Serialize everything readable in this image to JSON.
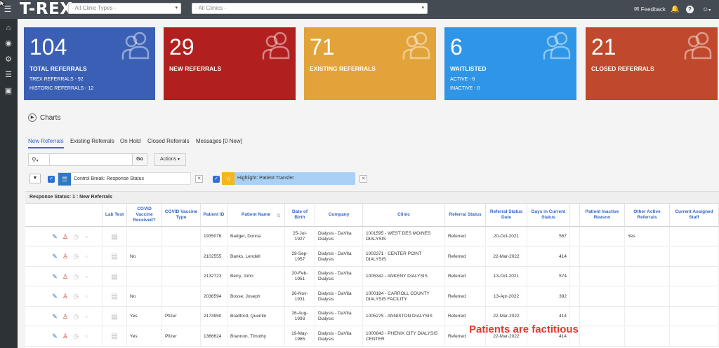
{
  "topbar": {
    "menu_icon": "hamburger-icon",
    "logo": "T-REX",
    "clinic_types": {
      "selected": "- All Clinic Types -"
    },
    "clinics": {
      "selected": "- All Clinics -"
    },
    "feedback_label": "Feedback",
    "feedback_icon": "chat-bubble-icon",
    "notifications_icon": "bell-icon",
    "help_icon": "question-icon",
    "user_icon": "user-icon"
  },
  "sidebar": {
    "items": [
      {
        "icon": "home-icon"
      },
      {
        "icon": "eye-slash-icon"
      },
      {
        "icon": "gear-icon"
      },
      {
        "icon": "list-icon"
      },
      {
        "icon": "book-icon"
      }
    ]
  },
  "cards": [
    {
      "value": "104",
      "label": "TOTAL REFERRALS",
      "sub1": "TREX REFERRALS - 92",
      "sub2": "HISTORIC REFERRALS - 12",
      "color": "#3a5fb4"
    },
    {
      "value": "29",
      "label": "NEW REFERRALS",
      "sub1": "",
      "sub2": "",
      "color": "#b21f1f"
    },
    {
      "value": "71",
      "label": "EXISTING REFERRALS",
      "sub1": "",
      "sub2": "",
      "color": "#e2a33a"
    },
    {
      "value": "6",
      "label": "WAITLISTED",
      "sub1": "ACTIVE - 6",
      "sub2": "INACTIVE - 0",
      "color": "#2f95e6"
    },
    {
      "value": "21",
      "label": "CLOSED REFERRALS",
      "sub1": "",
      "sub2": "",
      "color": "#c0492d"
    }
  ],
  "charts": {
    "label": "Charts"
  },
  "tabs": [
    {
      "label": "New Referrals",
      "active": true
    },
    {
      "label": "Existing Referrals",
      "active": false
    },
    {
      "label": "On Hold",
      "active": false
    },
    {
      "label": "Closed Referrals",
      "active": false
    },
    {
      "label": "Messages [0 New]",
      "active": false
    }
  ],
  "toolbar": {
    "search_value": "",
    "go_label": "Go",
    "actions_label": "Actions"
  },
  "filters": {
    "control_break": "Control Break: Response Status",
    "highlight": "Highlight: Patient Transfer"
  },
  "table": {
    "group_header": "Response Status: 1 : New Referrals",
    "columns": [
      "",
      "Lab Test",
      "COVID Vaccine Received?",
      "COVID Vaccine Type",
      "Patient ID",
      "Patient Name",
      "Date of Birth",
      "Company",
      "Clinic",
      "Referral Status",
      "Referral Status Date",
      "Days in Current Status",
      "",
      "Patient Inactive Reason",
      "Other Active Referrals",
      "Current Assigned Staff"
    ],
    "rows": [
      {
        "covid": "",
        "type": "",
        "id": "1935076",
        "name": "Badger, Donna",
        "dob": "25-Jul-1927",
        "company": "Dialysis - DaVita Dialysis",
        "clinic": "1001595 - WEST DES MOINES DIALYSIS",
        "status": "Referred",
        "date": "20-Oct-2021",
        "days": "567",
        "reason": "",
        "other": "Yes",
        "staff": ""
      },
      {
        "covid": "No",
        "type": "",
        "id": "2102555",
        "name": "Banks, Lendell",
        "dob": "29-Sep-1957",
        "company": "Dialysis - DaVita Dialysis",
        "clinic": "1002371 - CENTER POINT DIALYSIS",
        "status": "Referred",
        "date": "22-Mar-2022",
        "days": "414",
        "reason": "",
        "other": "",
        "staff": ""
      },
      {
        "covid": "",
        "type": "",
        "id": "2132723",
        "name": "Berry, John",
        "dob": "20-Feb-1951",
        "company": "Dialysis - DaVita Dialysis",
        "clinic": "1005342 - ANKENY DIALYSIS",
        "status": "Referred",
        "date": "13-Oct-2021",
        "days": "574",
        "reason": "",
        "other": "",
        "staff": ""
      },
      {
        "covid": "No",
        "type": "",
        "id": "2036594",
        "name": "Bosse, Joseph",
        "dob": "26-Nov-1931",
        "company": "Dialysis - DaVita Dialysis",
        "clinic": "1000184 - CARROLL COUNTY DIALYSIS FACILITY",
        "status": "Referred",
        "date": "13-Apr-2022",
        "days": "392",
        "reason": "",
        "other": "",
        "staff": ""
      },
      {
        "covid": "Yes",
        "type": "Pfizer",
        "id": "2173950",
        "name": "Bradford, Quentin",
        "dob": "26-Aug-1993",
        "company": "Dialysis - DaVita Dialysis",
        "clinic": "1005275 - ANNISTON DIALYSIS",
        "status": "Referred",
        "date": "22-Mar-2022",
        "days": "414",
        "reason": "",
        "other": "",
        "staff": ""
      },
      {
        "covid": "Yes",
        "type": "Pfizer",
        "id": "1366624",
        "name": "Brannon, Timothy",
        "dob": "19-May-1965",
        "company": "Dialysis - DaVita Dialysis",
        "clinic": "1000843 - PHENIX CITY DIALYSIS CENTER",
        "status": "Referred",
        "date": "22-Mar-2022",
        "days": "414",
        "reason": "",
        "other": "",
        "staff": ""
      }
    ]
  },
  "overlay_note": "Patients are factitious"
}
